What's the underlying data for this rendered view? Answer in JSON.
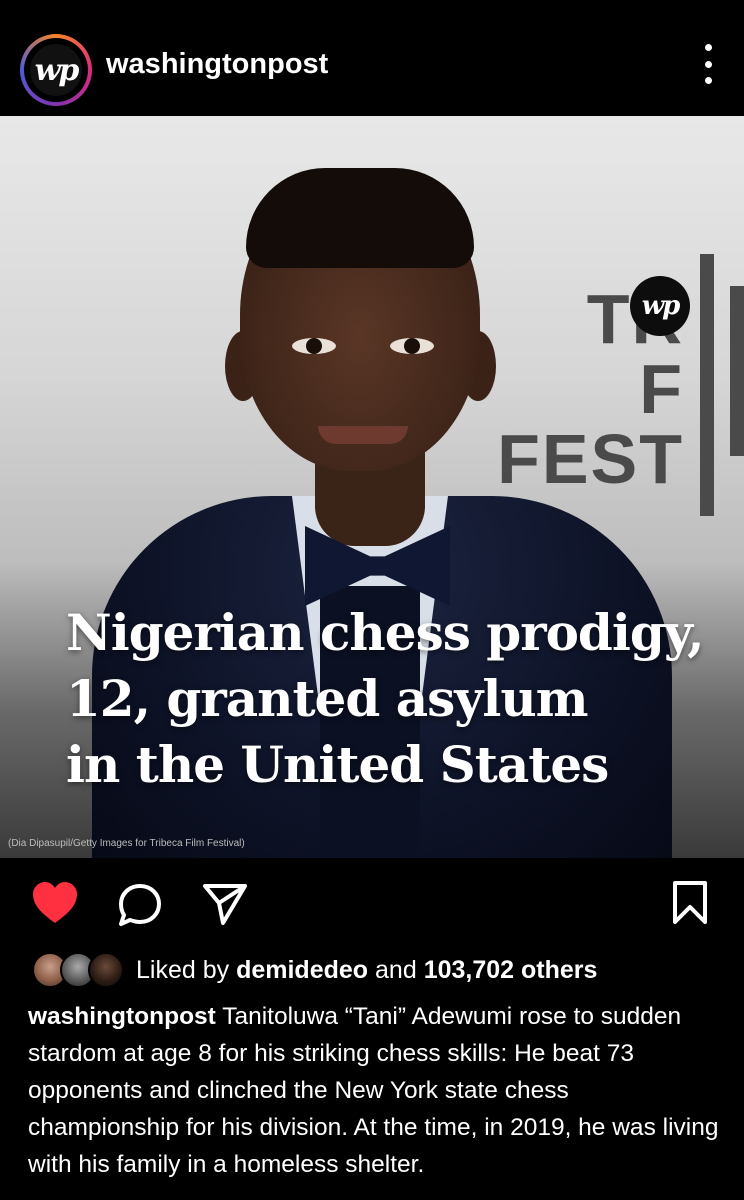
{
  "header": {
    "avatar_initials": "wp",
    "username": "washingtonpost",
    "more_icon": "more-vertical-icon"
  },
  "post": {
    "badge_initials": "wp",
    "background_sign": [
      "TR",
      "F",
      "FEST"
    ],
    "headline": "Nigerian chess prodigy,\n12, granted asylum\nin the United States",
    "photo_credit": "(Dia Dipasupil/Getty Images for Tribeca Film Festival)"
  },
  "actions": {
    "like_icon": "heart-filled-icon",
    "comment_icon": "comment-icon",
    "share_icon": "send-icon",
    "save_icon": "bookmark-icon",
    "like_color": "#ff3040"
  },
  "likes": {
    "prefix": "Liked by",
    "user": "demidedeo",
    "middle": "and",
    "others": "103,702 others"
  },
  "caption": {
    "username": "washingtonpost",
    "text": "Tanitoluwa “Tani” Adewumi rose to sudden stardom at age 8 for his striking chess skills: He beat 73 opponents and clinched the New York state chess championship for his division. At the time, in 2019, he was living with his family in a homeless shelter."
  }
}
